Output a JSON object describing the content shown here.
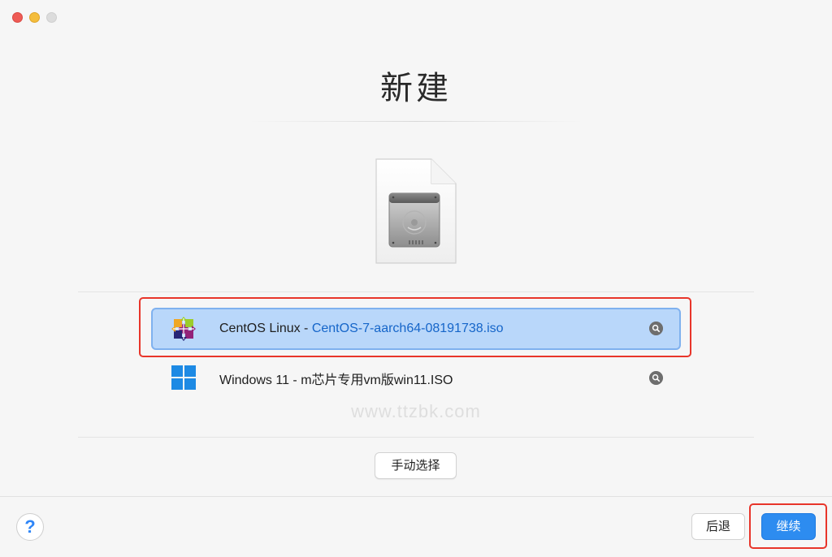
{
  "window": {
    "title": "新建",
    "watermark": "www.ttzbk.com"
  },
  "os_list": [
    {
      "name": "CentOS Linux",
      "separator": " - ",
      "file": "CentOS-7-aarch64-08191738.iso",
      "icon": "centos-logo-icon",
      "selected": true
    },
    {
      "name": "Windows 11",
      "separator": " - ",
      "file": "m芯片专用vm版win11.ISO",
      "icon": "windows-logo-icon",
      "selected": false
    }
  ],
  "buttons": {
    "manual_select": "手动选择",
    "help": "?",
    "back": "后退",
    "continue": "继续"
  },
  "colors": {
    "selection_bg": "#b9d7fa",
    "accent": "#2d8cf0",
    "annotation": "#e8352a"
  }
}
